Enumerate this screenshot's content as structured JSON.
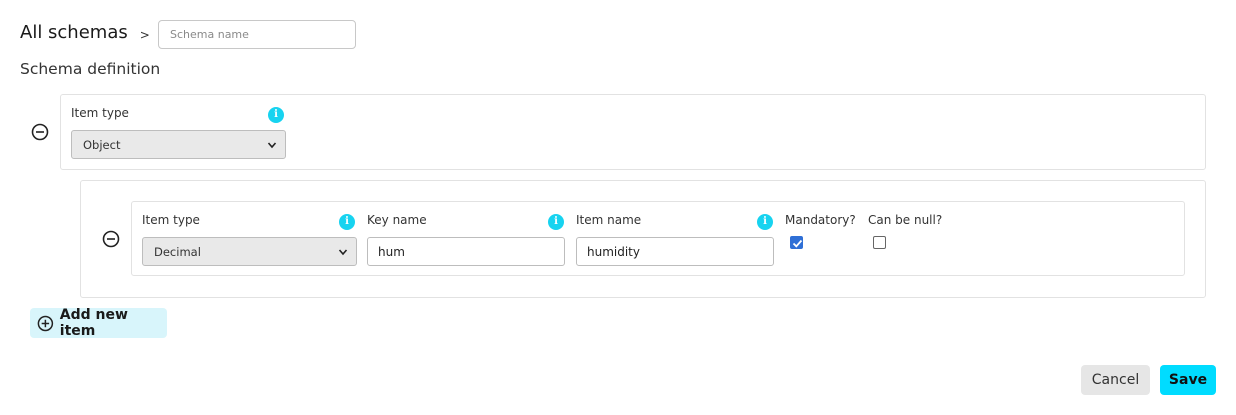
{
  "breadcrumb": {
    "root": "All schemas",
    "separator": ">",
    "schema_name_placeholder": "Schema name",
    "schema_name_value": ""
  },
  "section_title": "Schema definition",
  "root_item": {
    "item_type_label": "Item type",
    "item_type_value": "Object"
  },
  "child_item": {
    "item_type_label": "Item type",
    "item_type_value": "Decimal",
    "key_name_label": "Key name",
    "key_name_value": "hum",
    "item_name_label": "Item name",
    "item_name_value": "humidity",
    "mandatory_label": "Mandatory?",
    "mandatory_checked": true,
    "nullable_label": "Can be null?",
    "nullable_checked": false
  },
  "add_item_label": "Add new item",
  "actions": {
    "cancel_label": "Cancel",
    "save_label": "Save"
  },
  "colors": {
    "accent": "#00dcff",
    "info_icon": "#17d3f0",
    "add_item_bg": "#d8f5fb",
    "checkbox_checked": "#2f6fd6"
  }
}
